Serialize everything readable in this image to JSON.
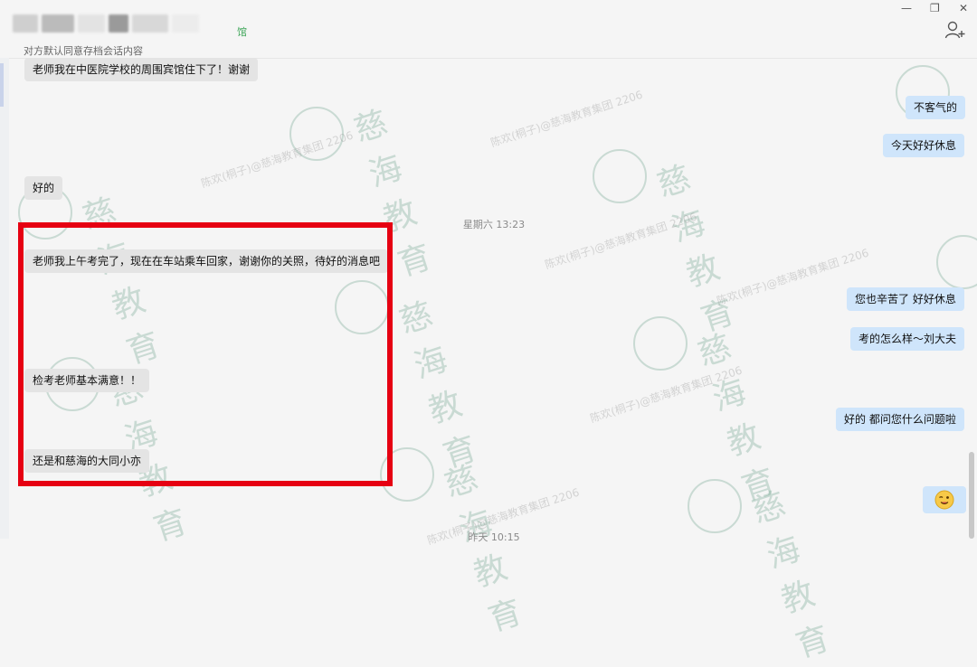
{
  "header": {
    "tag": "馆",
    "subtitle": "对方默认同意存档会话内容"
  },
  "window_controls": {
    "minimize": "—",
    "restore": "❐",
    "close": "✕"
  },
  "watermark": {
    "brand": "慈海教育",
    "sub": "陈欢(桐子)@慈海教育集团 2206"
  },
  "messages": {
    "m0": "老师我在中医院学校的周围宾馆住下了！谢谢",
    "m1": "不客气的",
    "m2": "今天好好休息",
    "m3": "好的",
    "t1": "星期六 13:23",
    "m4": "老师我上午考完了，现在在车站乘车回家，谢谢你的关照，待好的消息吧",
    "m5": "您也辛苦了 好好休息",
    "m6": "考的怎么样～刘大夫",
    "m7": "检考老师基本满意！！",
    "m8": "好的 都问您什么问题啦",
    "m9": "还是和慈海的大同小亦",
    "t2": "昨天 10:15"
  },
  "icons": {
    "add_contact": "add-contact-icon",
    "emoji": "wink-emoji-icon"
  },
  "colors": {
    "highlight_box": "#e60012",
    "outgoing_bubble": "#cfe5fb",
    "incoming_bubble": "#e4e4e4"
  }
}
